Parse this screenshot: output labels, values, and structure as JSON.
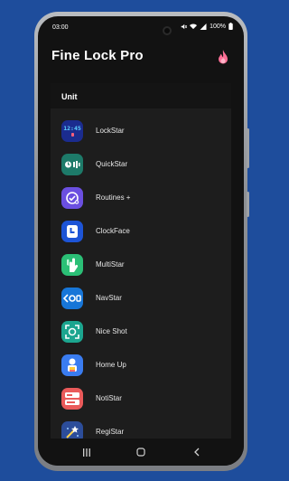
{
  "status": {
    "time": "03:00",
    "battery": "100%"
  },
  "app": {
    "title": "Fine Lock Pro"
  },
  "section": {
    "title": "Unit"
  },
  "items": [
    {
      "label": "LockStar",
      "icon": "lockstar-icon",
      "color": "#1b2c8f",
      "clock": "12:45"
    },
    {
      "label": "QuickStar",
      "icon": "quickstar-icon",
      "color": "#1d7a69"
    },
    {
      "label": "Routines +",
      "icon": "routines-icon",
      "color": "#6b4fe0"
    },
    {
      "label": "ClockFace",
      "icon": "clockface-icon",
      "color": "#1d54d6"
    },
    {
      "label": "MultiStar",
      "icon": "multistar-icon",
      "color": "#2bbf76"
    },
    {
      "label": "NavStar",
      "icon": "navstar-icon",
      "color": "#1776d8"
    },
    {
      "label": "Nice Shot",
      "icon": "niceshot-icon",
      "color": "#1ca58f"
    },
    {
      "label": "Home Up",
      "icon": "homeup-icon",
      "color": "#3a7cf0"
    },
    {
      "label": "NotiStar",
      "icon": "notistar-icon",
      "color": "#ea5a5a"
    },
    {
      "label": "RegiStar",
      "icon": "registar-icon",
      "color": "#2c4d9a"
    }
  ]
}
